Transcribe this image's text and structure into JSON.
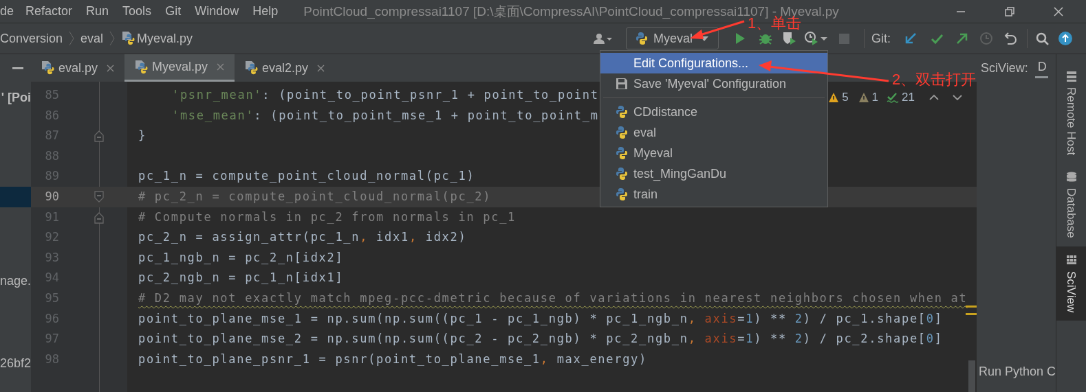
{
  "menu": [
    "de",
    "Refactor",
    "Run",
    "Tools",
    "Git",
    "Window",
    "Help"
  ],
  "window": {
    "title": "PointCloud_compressai1107 [D:\\桌面\\CompressAI\\PointCloud_compressai1107] - Myeval.py"
  },
  "breadcrumb": [
    "Conversion",
    "eval",
    "Myeval.py"
  ],
  "run_config": {
    "label": "Myeval"
  },
  "git_label": "Git:",
  "tabs": [
    {
      "label": "eval.py",
      "selected": false
    },
    {
      "label": "Myeval.py",
      "selected": true
    },
    {
      "label": "eval2.py",
      "selected": false
    }
  ],
  "project_panel": {
    "items": [
      {
        "text": "' [Poi",
        "selected": false
      },
      {
        "selected": true
      },
      {
        "text": "nage.",
        "selected": false
      },
      {
        "text": "26bf2",
        "selected": false
      }
    ]
  },
  "code_lines": [
    {
      "number": "85",
      "current": false,
      "warning": false,
      "indented": true,
      "segments": [
        {
          "kind": "string",
          "text": "'psnr_mean'"
        },
        {
          "kind": "plain",
          "text": ": (point_to_point_psnr_1 + point_to_point"
        }
      ]
    },
    {
      "number": "86",
      "current": false,
      "warning": false,
      "indented": true,
      "segments": [
        {
          "kind": "string",
          "text": "'mse_mean'"
        },
        {
          "kind": "plain",
          "text": ": (point_to_point_mse_1 + point_to_point_m"
        }
      ]
    },
    {
      "number": "87",
      "current": false,
      "warning": false,
      "indented": false,
      "fold_end": true,
      "segments": [
        {
          "kind": "plain",
          "text": "}"
        }
      ]
    },
    {
      "number": "88",
      "current": false
    },
    {
      "number": "89",
      "current": false,
      "warning": false,
      "indented": false,
      "segments": [
        {
          "kind": "plain",
          "text": "pc_1_n = compute_point_cloud_normal(pc_1)"
        }
      ]
    },
    {
      "number": "90",
      "current": true,
      "warning": false,
      "indented": false,
      "fold_start": true,
      "segments": [
        {
          "kind": "comment",
          "text": "# pc_2_n = compute_point_cloud_normal(pc_2)"
        }
      ]
    },
    {
      "number": "91",
      "current": false,
      "warning": false,
      "indented": false,
      "fold_end": true,
      "segments": [
        {
          "kind": "comment",
          "text": "# Compute normals in pc_2 from normals in pc_1"
        }
      ]
    },
    {
      "number": "92",
      "current": false,
      "warning": false,
      "indented": false,
      "segments": [
        {
          "kind": "plain",
          "text": "pc_2_n = assign_attr(pc_1_n"
        },
        {
          "kind": "punct",
          "text": ","
        },
        {
          "kind": "plain",
          "text": " idx1"
        },
        {
          "kind": "punct",
          "text": ","
        },
        {
          "kind": "plain",
          "text": " idx2)"
        }
      ]
    },
    {
      "number": "93",
      "current": false,
      "warning": false,
      "indented": false,
      "segments": [
        {
          "kind": "plain",
          "text": "pc_1_ngb_n = pc_2_n[idx2]"
        }
      ]
    },
    {
      "number": "94",
      "current": false,
      "warning": false,
      "indented": false,
      "segments": [
        {
          "kind": "plain",
          "text": "pc_2_ngb_n = pc_1_n[idx1]"
        }
      ]
    },
    {
      "number": "95",
      "current": false,
      "warning": true,
      "indented": false,
      "segments": [
        {
          "kind": "comment",
          "text": "# D2 may not exactly match mpeg-pcc-dmetric because of variations in nearest neighbors chosen when at"
        }
      ]
    },
    {
      "number": "96",
      "current": false,
      "warning": false,
      "indented": false,
      "segments": [
        {
          "kind": "plain",
          "text": "point_to_plane_mse_1 = np.sum(np.sum((pc_1 - pc_1_ngb) * pc_1_ngb_n"
        },
        {
          "kind": "punct",
          "text": ", "
        },
        {
          "kind": "param",
          "text": "axis"
        },
        {
          "kind": "plain",
          "text": "="
        },
        {
          "kind": "number",
          "text": "1"
        },
        {
          "kind": "plain",
          "text": ") ** "
        },
        {
          "kind": "number",
          "text": "2"
        },
        {
          "kind": "plain",
          "text": ") / pc_1.shape["
        },
        {
          "kind": "number",
          "text": "0"
        },
        {
          "kind": "plain",
          "text": "]"
        }
      ]
    },
    {
      "number": "97",
      "current": false,
      "warning": false,
      "indented": false,
      "segments": [
        {
          "kind": "plain",
          "text": "point_to_plane_mse_2 = np.sum(np.sum((pc_2 - pc_2_ngb) * pc_2_ngb_n"
        },
        {
          "kind": "punct",
          "text": ", "
        },
        {
          "kind": "param",
          "text": "axis"
        },
        {
          "kind": "plain",
          "text": "="
        },
        {
          "kind": "number",
          "text": "1"
        },
        {
          "kind": "plain",
          "text": ") ** "
        },
        {
          "kind": "number",
          "text": "2"
        },
        {
          "kind": "plain",
          "text": ") / pc_2.shape["
        },
        {
          "kind": "number",
          "text": "0"
        },
        {
          "kind": "plain",
          "text": "]"
        }
      ]
    },
    {
      "number": "98",
      "current": false,
      "warning": false,
      "indented": false,
      "segments": [
        {
          "kind": "plain",
          "text": "point_to_plane_psnr_1 = psnr(point_to_plane_mse_1"
        },
        {
          "kind": "punct",
          "text": ","
        },
        {
          "kind": "plain",
          "text": " max_energy)"
        }
      ]
    }
  ],
  "inspections": {
    "warnings": "5",
    "weak_warnings": "1",
    "typos": "21"
  },
  "dropdown": {
    "items": [
      {
        "kind": "action",
        "label": "Edit Configurations...",
        "selected": true
      },
      {
        "kind": "save",
        "label": "Save 'Myeval' Configuration",
        "selected": false
      },
      {
        "kind": "separator"
      },
      {
        "kind": "config",
        "label": "CDdistance",
        "selected": false
      },
      {
        "kind": "config",
        "label": "eval",
        "selected": false
      },
      {
        "kind": "config",
        "label": "Myeval",
        "selected": false
      },
      {
        "kind": "config",
        "label": "test_MingGanDu",
        "selected": false
      },
      {
        "kind": "config",
        "label": "train",
        "selected": false
      }
    ]
  },
  "sciview": {
    "tabs": [
      "SciView:",
      "D"
    ],
    "footer": "Run Python C"
  },
  "side_tabs": [
    {
      "label": "Remote Host",
      "selected": false
    },
    {
      "label": "Database",
      "selected": false
    },
    {
      "label": "SciView",
      "selected": true
    }
  ],
  "annotations": [
    {
      "text": "1、单击"
    },
    {
      "text": "2、双击打开"
    }
  ]
}
